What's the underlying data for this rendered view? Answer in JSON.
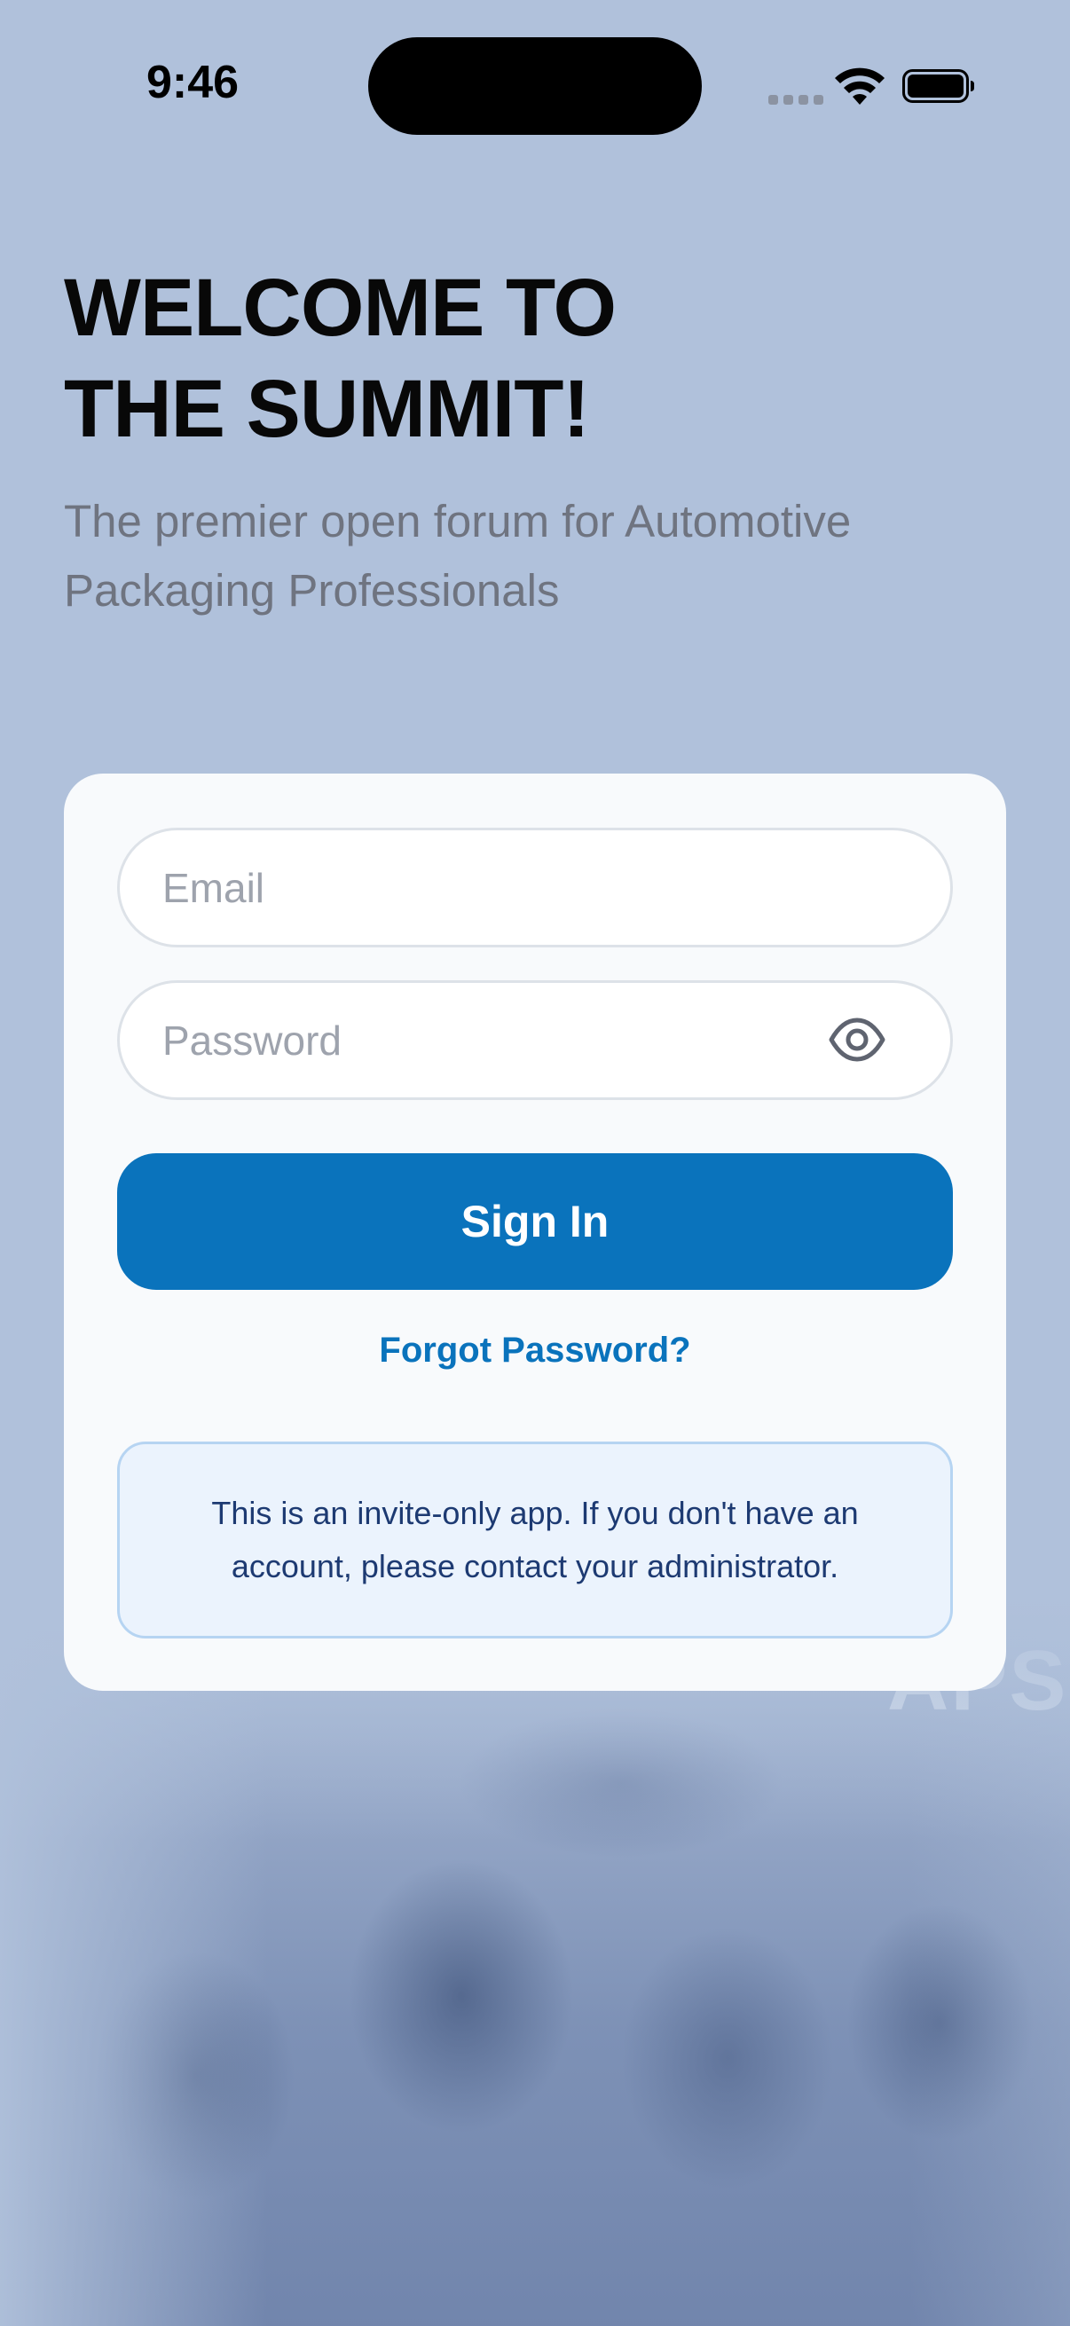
{
  "status_bar": {
    "time": "9:46"
  },
  "header": {
    "title_line1": "WELCOME TO",
    "title_line2": "THE SUMMIT!",
    "subtitle": "The premier open forum for Automotive Packaging Professionals"
  },
  "login_form": {
    "email": {
      "placeholder": "Email",
      "value": ""
    },
    "password": {
      "placeholder": "Password",
      "value": "",
      "visibility_icon": "eye-icon"
    },
    "sign_in_label": "Sign In",
    "forgot_password_label": "Forgot Password?",
    "notice_text": "This is an invite-only app. If you don't have an account, please contact your administrator."
  },
  "background": {
    "banner_text": "APS"
  },
  "colors": {
    "background": "#b0c1db",
    "card": "#f8fafc",
    "primary": "#0a73bc",
    "notice_bg": "#ebf3fd",
    "notice_border": "#b6d4f2",
    "notice_text": "#1d3a72",
    "subtitle_text": "#6f7480"
  }
}
